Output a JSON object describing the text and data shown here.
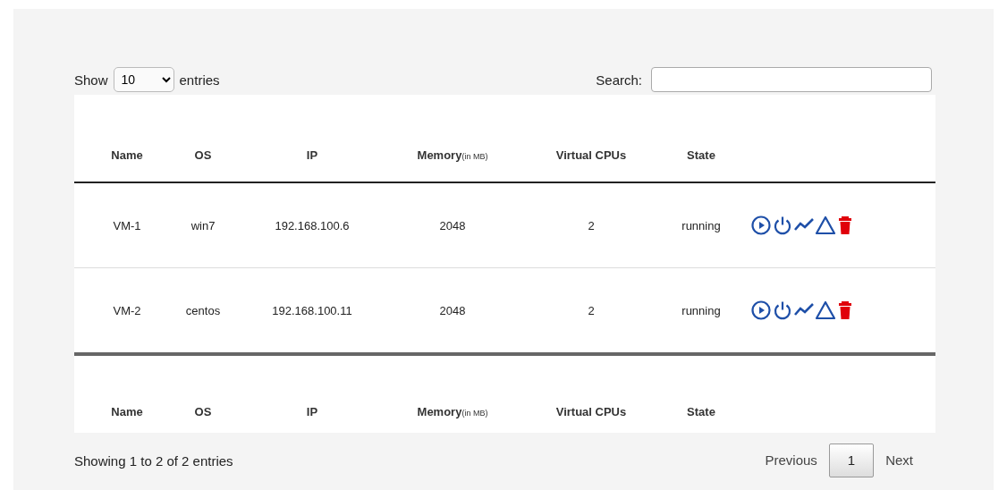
{
  "length_control": {
    "prefix": "Show",
    "value": "10",
    "suffix": "entries"
  },
  "search": {
    "label": "Search:"
  },
  "table": {
    "columns": [
      {
        "label": "Name"
      },
      {
        "label": "OS"
      },
      {
        "label": "IP"
      },
      {
        "label": "Memory",
        "unit": "(in MB)"
      },
      {
        "label": "Virtual CPUs"
      },
      {
        "label": "State"
      }
    ],
    "rows": [
      {
        "cells": [
          "VM-1",
          "win7",
          "192.168.100.6",
          "2048",
          "2",
          "running"
        ]
      },
      {
        "cells": [
          "VM-2",
          "centos",
          "192.168.100.11",
          "2048",
          "2",
          "running"
        ]
      }
    ]
  },
  "footer_columns": [
    {
      "label": "Name"
    },
    {
      "label": "OS"
    },
    {
      "label": "IP"
    },
    {
      "label": "Memory",
      "unit": "(in MB)"
    },
    {
      "label": "Virtual CPUs"
    },
    {
      "label": "State"
    }
  ],
  "info": "Showing 1 to 2 of 2 entries",
  "pagination": [
    {
      "label": "Previous",
      "selected": false
    },
    {
      "label": "1",
      "selected": true
    },
    {
      "label": "Next",
      "selected": false
    }
  ]
}
